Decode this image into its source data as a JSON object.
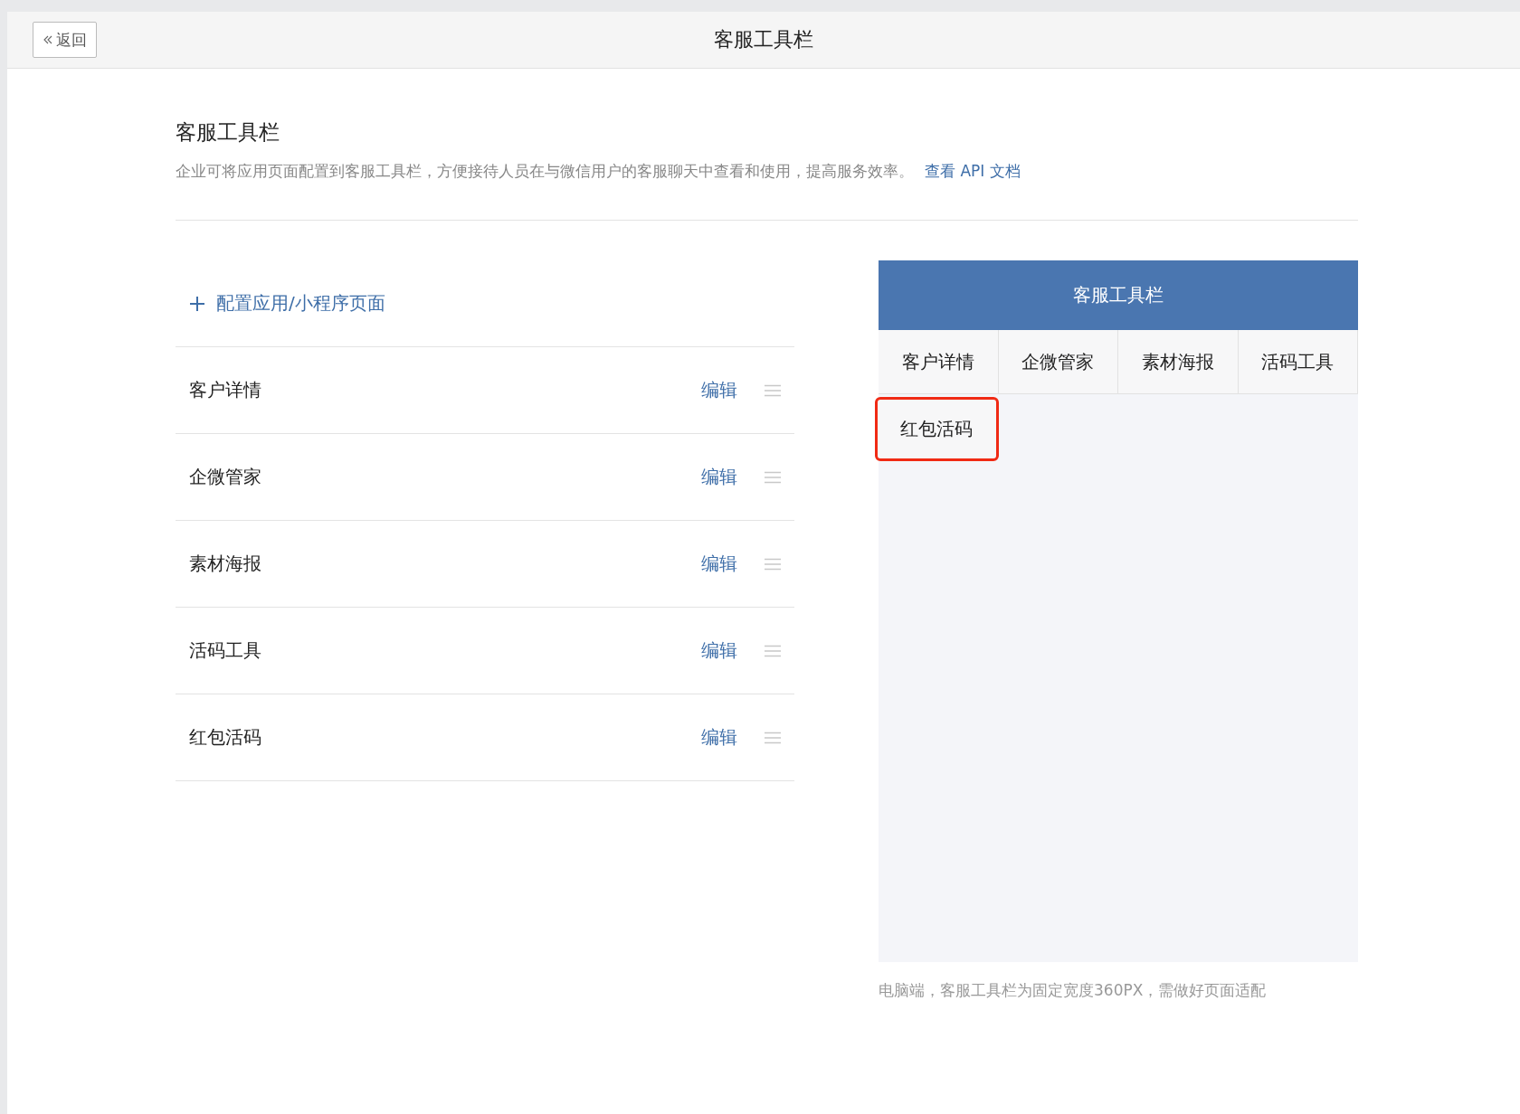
{
  "topbar": {
    "back_label": "返回",
    "title": "客服工具栏"
  },
  "section": {
    "title": "客服工具栏",
    "description": "企业可将应用页面配置到客服工具栏，方便接待人员在与微信用户的客服聊天中查看和使用，提高服务效率。",
    "link": "查看 API 文档"
  },
  "add_link": "配置应用/小程序页面",
  "items": [
    {
      "name": "客户详情",
      "action": "编辑"
    },
    {
      "name": "企微管家",
      "action": "编辑"
    },
    {
      "name": "素材海报",
      "action": "编辑"
    },
    {
      "name": "活码工具",
      "action": "编辑"
    },
    {
      "name": "红包活码",
      "action": "编辑"
    }
  ],
  "preview": {
    "title": "客服工具栏",
    "tools": [
      {
        "label": "客户详情",
        "highlighted": false
      },
      {
        "label": "企微管家",
        "highlighted": false
      },
      {
        "label": "素材海报",
        "highlighted": false
      },
      {
        "label": "活码工具",
        "highlighted": false
      },
      {
        "label": "红包活码",
        "highlighted": true
      }
    ],
    "note": "电脑端，客服工具栏为固定宽度360PX，需做好页面适配"
  }
}
